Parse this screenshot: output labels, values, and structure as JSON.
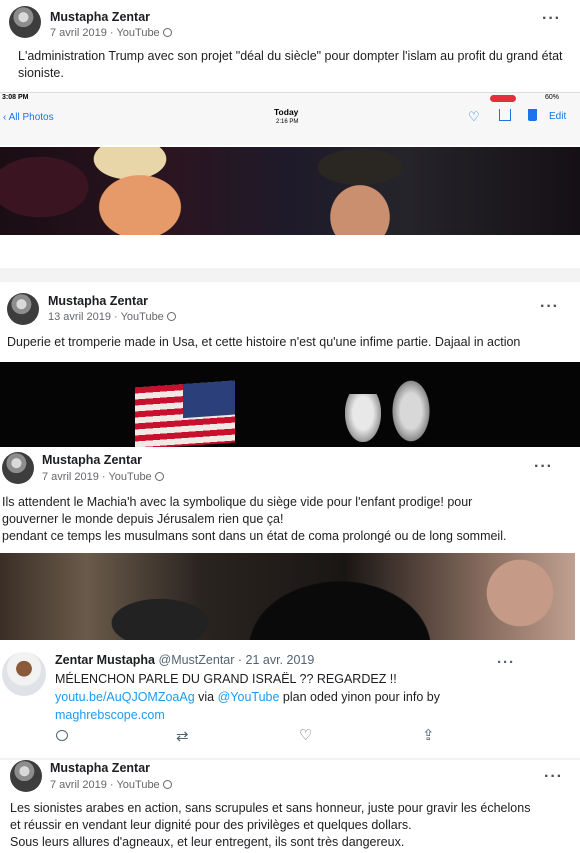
{
  "posts": [
    {
      "author": "Mustapha Zentar",
      "date": "7 avril 2019",
      "source": "YouTube",
      "text": "L'administration Trump avec son projet \"déal du siècle\" pour dompter l'islam au profit du grand état sioniste.",
      "phone_bar": {
        "time": "3:08 PM",
        "back_label": "All Photos",
        "center_title": "Today",
        "center_time": "2:16 PM",
        "edit_label": "Edit",
        "battery": "60%"
      }
    },
    {
      "author": "Mustapha Zentar",
      "date": "13 avril 2019",
      "source": "YouTube",
      "text": "Duperie et tromperie made in Usa, et cette histoire n'est qu'une infime partie. Dajaal in action"
    },
    {
      "author": "Mustapha Zentar",
      "date": "7 avril 2019",
      "source": "YouTube",
      "text_lines": [
        "Ils attendent le Machia'h avec la symbolique du siège vide pour l'enfant prodige! pour",
        "gouverner le monde depuis Jérusalem rien que ça!",
        "pendant ce temps les musulmans sont dans un état de coma prolongé ou de long sommeil."
      ]
    },
    {
      "author": "Mustapha Zentar",
      "date": "7 avril 2019",
      "source": "YouTube",
      "text_lines": [
        "Les sionistes arabes en action, sans scrupules et sans honneur, juste pour gravir les échelons",
        "et réussir en vendant leur dignité pour des privilèges et quelques dollars.",
        "Sous leurs allures d'agneaux, et leur entregent, ils sont très dangereux."
      ]
    }
  ],
  "tweet": {
    "name": "Zentar Mustapha",
    "handle": "@MustZentar",
    "date": "21 avr. 2019",
    "line1": "MÉLENCHON PARLE DU GRAND ISRAËL ?? REGARDEZ !!",
    "link1": "youtu.be/AuQJOMZoaAg",
    "via": "via",
    "mention": "@YouTube",
    "rest": "plan oded yinon pour info by",
    "link2": "maghrebscope.com"
  },
  "colors": {
    "link": "#1d9bf0",
    "flag_red": "#c8102e",
    "flag_blue": "#2b3f7a"
  },
  "icons": [
    "globe-icon",
    "more-dots-icon",
    "reply-icon",
    "retweet-icon",
    "like-icon",
    "share-icon",
    "heart-icon",
    "trash-icon"
  ]
}
